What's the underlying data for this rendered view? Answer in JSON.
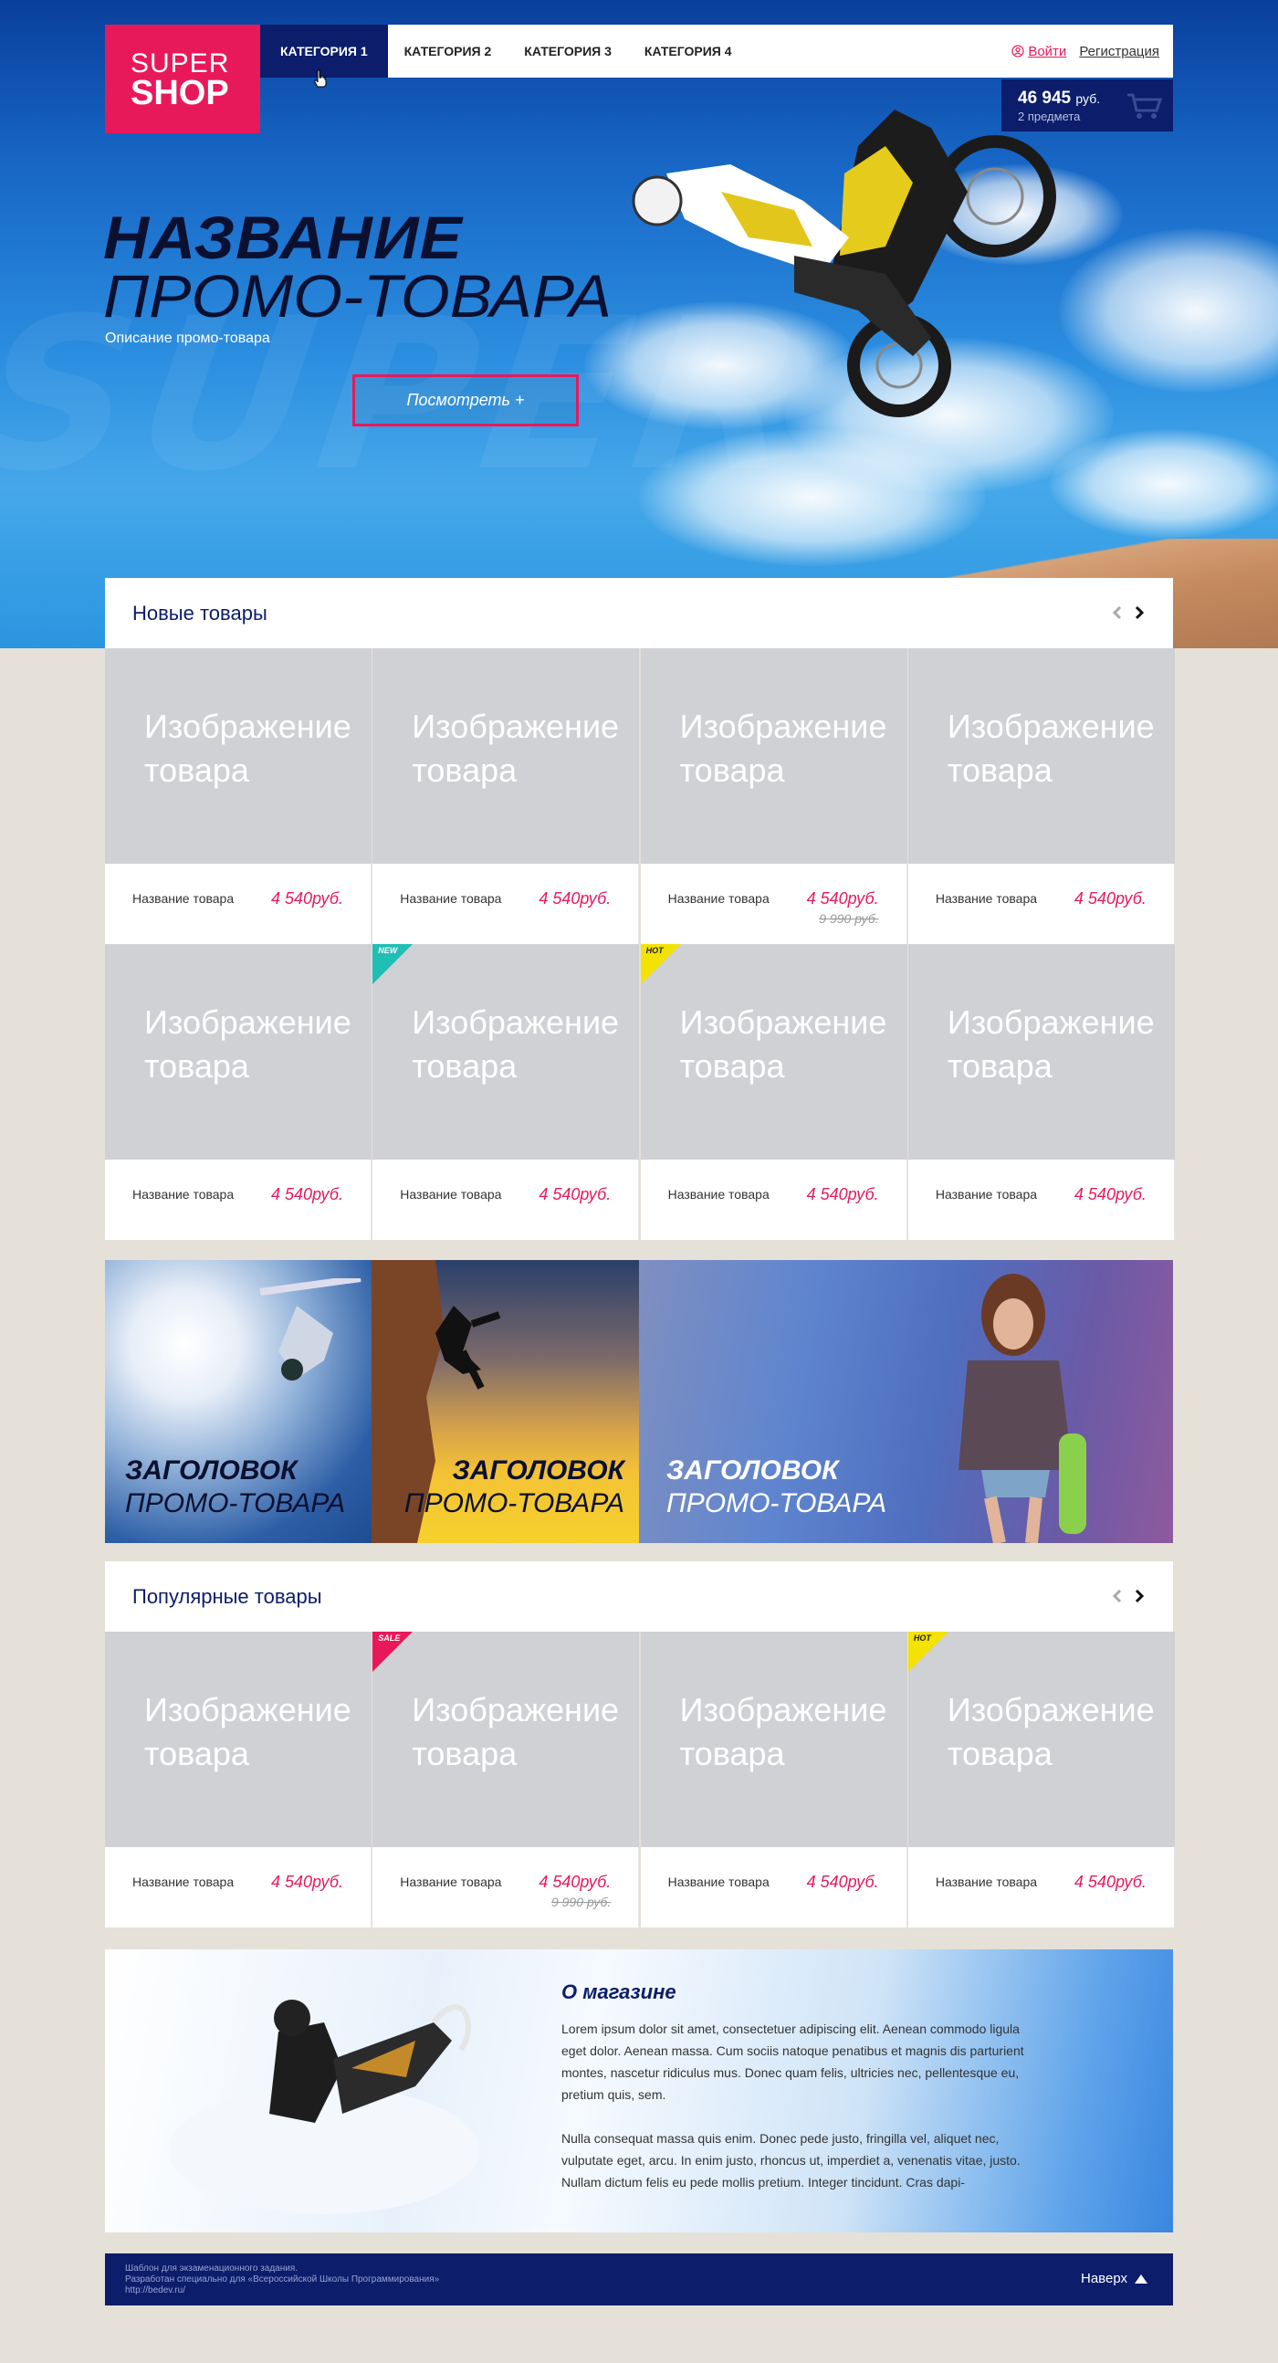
{
  "logo": {
    "line1": "SUPER",
    "line2": "SHOP"
  },
  "nav": [
    {
      "label": "Категория 1",
      "active": true
    },
    {
      "label": "Категория 2"
    },
    {
      "label": "Категория 3"
    },
    {
      "label": "Категория 4"
    }
  ],
  "auth": {
    "login": "Войти",
    "register": "Регистрация"
  },
  "cart": {
    "sum": "46 945",
    "currency": "руб.",
    "count": "2 предмета"
  },
  "hero": {
    "title_bold": "Название",
    "title_light": "промо-товара",
    "description": "Описание промо-товара",
    "button": "Посмотреть +",
    "watermark": "SUPER"
  },
  "new_products": {
    "title": "Новые товары",
    "items": [
      {
        "placeholder1": "Изображение",
        "placeholder2": "товара",
        "name": "Название товара",
        "price": "4 540руб.",
        "old_price": "",
        "badge": ""
      },
      {
        "placeholder1": "Изображение",
        "placeholder2": "товара",
        "name": "Название товара",
        "price": "4 540руб.",
        "old_price": "",
        "badge": ""
      },
      {
        "placeholder1": "Изображение",
        "placeholder2": "товара",
        "name": "Название товара",
        "price": "4 540руб.",
        "old_price": "9 990 руб.",
        "badge": ""
      },
      {
        "placeholder1": "Изображение",
        "placeholder2": "товара",
        "name": "Название товара",
        "price": "4 540руб.",
        "old_price": "",
        "badge": ""
      },
      {
        "placeholder1": "Изображение",
        "placeholder2": "товара",
        "name": "Название товара",
        "price": "4 540руб.",
        "old_price": "",
        "badge": ""
      },
      {
        "placeholder1": "Изображение",
        "placeholder2": "товара",
        "name": "Название товара",
        "price": "4 540руб.",
        "old_price": "",
        "badge": "NEW"
      },
      {
        "placeholder1": "Изображение",
        "placeholder2": "товара",
        "name": "Название товара",
        "price": "4 540руб.",
        "old_price": "",
        "badge": "HOT"
      },
      {
        "placeholder1": "Изображение",
        "placeholder2": "товара",
        "name": "Название товара",
        "price": "4 540руб.",
        "old_price": "",
        "badge": ""
      }
    ]
  },
  "banners": [
    {
      "line1": "Заголовок",
      "line2": "промо-товара"
    },
    {
      "line1": "Заголовок",
      "line2": "промо-товара"
    },
    {
      "line1": "Заголовок",
      "line2": "промо-товара"
    }
  ],
  "popular_products": {
    "title": "Популярные товары",
    "items": [
      {
        "placeholder1": "Изображение",
        "placeholder2": "товара",
        "name": "Название товара",
        "price": "4 540руб.",
        "old_price": "",
        "badge": ""
      },
      {
        "placeholder1": "Изображение",
        "placeholder2": "товара",
        "name": "Название товара",
        "price": "4 540руб.",
        "old_price": "9 990 руб.",
        "badge": "SALE"
      },
      {
        "placeholder1": "Изображение",
        "placeholder2": "товара",
        "name": "Название товара",
        "price": "4 540руб.",
        "old_price": "",
        "badge": ""
      },
      {
        "placeholder1": "Изображение",
        "placeholder2": "товара",
        "name": "Название товара",
        "price": "4 540руб.",
        "old_price": "",
        "badge": "HOT"
      }
    ]
  },
  "about": {
    "title": "О магазине",
    "p1": "Lorem ipsum dolor sit amet, consectetuer adipiscing elit. Aenean commodo ligula eget dolor. Aenean massa. Cum sociis natoque penatibus et magnis dis parturient montes, nascetur ridiculus mus. Donec quam felis, ultricies nec, pellentesque eu, pretium quis, sem.",
    "p2": "Nulla consequat massa quis enim. Donec pede justo, fringilla vel, aliquet nec, vulputate eget, arcu. In enim justo, rhoncus ut, imperdiet a, venenatis vitae, justo. Nullam dictum felis eu pede mollis pretium. Integer tincidunt. Cras dapi-"
  },
  "footer": {
    "line1": "Шаблон для экзаменационного задания.",
    "line2": "Разработан специально для «Всероссийской Школы Программирования»",
    "line3": "http://bedev.ru/",
    "up": "Наверх"
  },
  "colors": {
    "accent": "#e8195a",
    "navy": "#0b1d6b",
    "new": "#1fbfb6",
    "hot": "#f4e200",
    "sale": "#e8195a"
  }
}
